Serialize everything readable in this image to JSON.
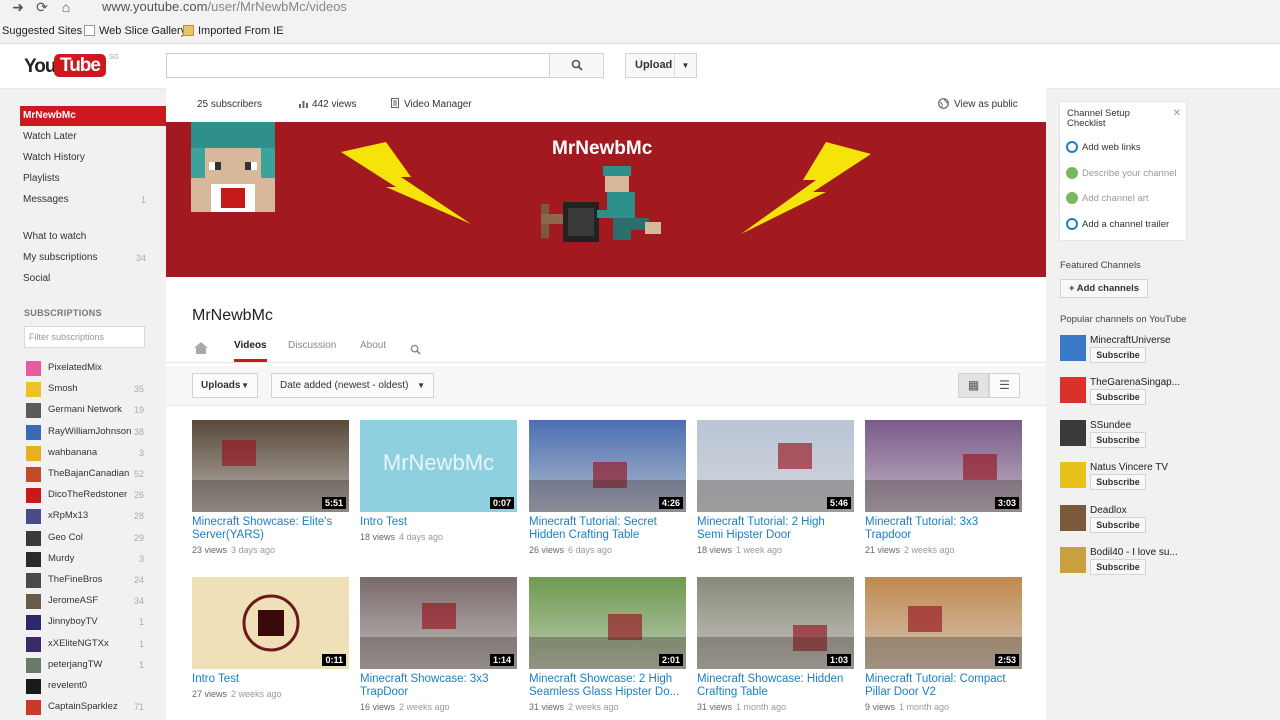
{
  "browser": {
    "url_host": "www.youtube.com",
    "url_path": "/user/MrNewbMc/videos",
    "bookmarks": [
      "Suggested Sites",
      "Web Slice Gallery",
      "Imported From IE"
    ]
  },
  "header": {
    "logo_you": "You",
    "logo_tube": "Tube",
    "logo_region": "SG",
    "search_placeholder": "",
    "upload_label": "Upload"
  },
  "guide": {
    "items": [
      {
        "label": "MrNewbMc",
        "count": ""
      },
      {
        "label": "Watch Later",
        "count": ""
      },
      {
        "label": "Watch History",
        "count": ""
      },
      {
        "label": "Playlists",
        "count": ""
      },
      {
        "label": "Messages",
        "count": "1"
      },
      {
        "label": "What to watch",
        "count": ""
      },
      {
        "label": "My subscriptions",
        "count": "34"
      },
      {
        "label": "Social",
        "count": ""
      }
    ],
    "subscriptions_heading": "SUBSCRIPTIONS",
    "filter_placeholder": "Filter subscriptions",
    "subscriptions": [
      {
        "name": "PixelatedMix",
        "count": ""
      },
      {
        "name": "Smosh",
        "count": "35"
      },
      {
        "name": "Germani Network",
        "count": "19"
      },
      {
        "name": "RayWilliamJohnson",
        "count": "38"
      },
      {
        "name": "wahbanana",
        "count": "3"
      },
      {
        "name": "TheBajanCanadian",
        "count": "52"
      },
      {
        "name": "DicoTheRedstoner",
        "count": "26"
      },
      {
        "name": "xRpMx13",
        "count": "28"
      },
      {
        "name": "Geo Col",
        "count": "29"
      },
      {
        "name": "Murdy",
        "count": "3"
      },
      {
        "name": "TheFineBros",
        "count": "24"
      },
      {
        "name": "JeromeASF",
        "count": "34"
      },
      {
        "name": "JinnyboyTV",
        "count": "1"
      },
      {
        "name": "xXEliteNGTXx",
        "count": "1"
      },
      {
        "name": "peterjangTW",
        "count": "1"
      },
      {
        "name": "revelent0",
        "count": ""
      },
      {
        "name": "CaptainSparklez",
        "count": "71"
      }
    ]
  },
  "channel": {
    "subscribers": "25 subscribers",
    "views": "442 views",
    "video_manager": "Video Manager",
    "view_as_public": "View as public",
    "banner_title": "MrNewbMc",
    "name": "MrNewbMc",
    "tabs": [
      "Videos",
      "Discussion",
      "About"
    ],
    "active_tab": "Videos",
    "uploads_dropdown": "Uploads",
    "sort_dropdown": "Date added (newest - oldest)"
  },
  "videos": [
    {
      "title": "Minecraft Showcase: Elite's Server(YARS)",
      "duration": "5:51",
      "views": "23 views",
      "ago": "3 days ago",
      "thumb": "#5a4a3a"
    },
    {
      "title": "Intro Test",
      "duration": "0:07",
      "views": "18 views",
      "ago": "4 days ago",
      "thumb": "#8fd0e0",
      "thumb_text": "MrNewbMc"
    },
    {
      "title": "Minecraft Tutorial: Secret Hidden Crafting Table",
      "duration": "4:26",
      "views": "26 views",
      "ago": "6 days ago",
      "thumb": "#4a6fb0"
    },
    {
      "title": "Minecraft Tutorial: 2 High Semi Hipster Door",
      "duration": "5:46",
      "views": "18 views",
      "ago": "1 week ago",
      "thumb": "#b9c4d6"
    },
    {
      "title": "Minecraft Tutorial: 3x3 Trapdoor",
      "duration": "3:03",
      "views": "21 views",
      "ago": "2 weeks ago",
      "thumb": "#7a5a8a"
    },
    {
      "title": "Intro Test",
      "duration": "0:11",
      "views": "27 views",
      "ago": "2 weeks ago",
      "thumb": "#efe0b8"
    },
    {
      "title": "Minecraft Showcase: 3x3 TrapDoor",
      "duration": "1:14",
      "views": "16 views",
      "ago": "2 weeks ago",
      "thumb": "#7b6a6a"
    },
    {
      "title": "Minecraft Showcase: 2 High Seamless Glass Hipster Do...",
      "duration": "2:01",
      "views": "31 views",
      "ago": "2 weeks ago",
      "thumb": "#6f9a4f"
    },
    {
      "title": "Minecraft Showcase: Hidden Crafting Table",
      "duration": "1:03",
      "views": "31 views",
      "ago": "1 month ago",
      "thumb": "#8a8a7a"
    },
    {
      "title": "Minecraft Tutorial: Compact Pillar Door V2",
      "duration": "2:53",
      "views": "9 views",
      "ago": "1 month ago",
      "thumb": "#c08a50"
    }
  ],
  "right": {
    "checklist_title": "Channel Setup Checklist",
    "checklist": [
      {
        "label": "Add web links",
        "done": false
      },
      {
        "label": "Describe your channel",
        "done": true
      },
      {
        "label": "Add channel art",
        "done": true
      },
      {
        "label": "Add a channel trailer",
        "done": false
      }
    ],
    "featured_heading": "Featured Channels",
    "add_channels": "+ Add channels",
    "popular_heading": "Popular channels on YouTube",
    "popular": [
      {
        "name": "MinecraftUniverse",
        "sub": "Subscribe",
        "color": "#3a78c8"
      },
      {
        "name": "TheGarenaSingap...",
        "sub": "Subscribe",
        "color": "#d8322a"
      },
      {
        "name": "SSundee",
        "sub": "Subscribe",
        "color": "#3a3a3a"
      },
      {
        "name": "Natus Vincere TV",
        "sub": "Subscribe",
        "color": "#e8c21a"
      },
      {
        "name": "Deadlox",
        "sub": "Subscribe",
        "color": "#7a5a3a"
      },
      {
        "name": "Bodil40 - I love su...",
        "sub": "Subscribe",
        "color": "#c8a040"
      }
    ]
  },
  "colors": {
    "accent": "#cc181e",
    "link": "#1b7fc3",
    "banner": "#a21a1f"
  }
}
